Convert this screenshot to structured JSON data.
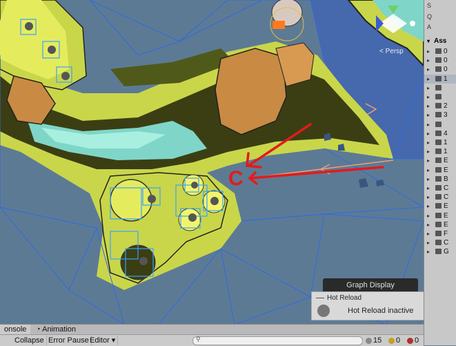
{
  "scene": {
    "view_label": "< Persp",
    "graph_display_title": "Graph Display",
    "hot_reload_title": "Hot Reload",
    "hot_reload_status": "Hot Reload inactive",
    "annotation_letter": "C"
  },
  "colors": {
    "scene_bg": "#5d7a95",
    "grass": "#c9d64a",
    "grass_dark": "#3b3e13",
    "water": "#7fd6c8",
    "rock": "#c98a43",
    "navmesh": "#2f6be0",
    "annotation": "#e21b1b"
  },
  "project": {
    "header": "Ass",
    "rows": [
      "0",
      "0",
      "0",
      "1",
      "",
      "",
      "2",
      "3",
      "",
      "4",
      "1",
      "1",
      "E",
      "E",
      "B",
      "C",
      "C",
      "E",
      "E",
      "E",
      "F",
      "C",
      "G"
    ],
    "top_icons": [
      "S",
      "Q",
      "A"
    ]
  },
  "console": {
    "tab_console": "onsole",
    "tab_animation": "Animation",
    "collapse": "Collapse",
    "error_pause": "Error Pause",
    "editor": "Editor ▾",
    "log_count": "15",
    "warn_count": "0",
    "error_count": "0"
  }
}
